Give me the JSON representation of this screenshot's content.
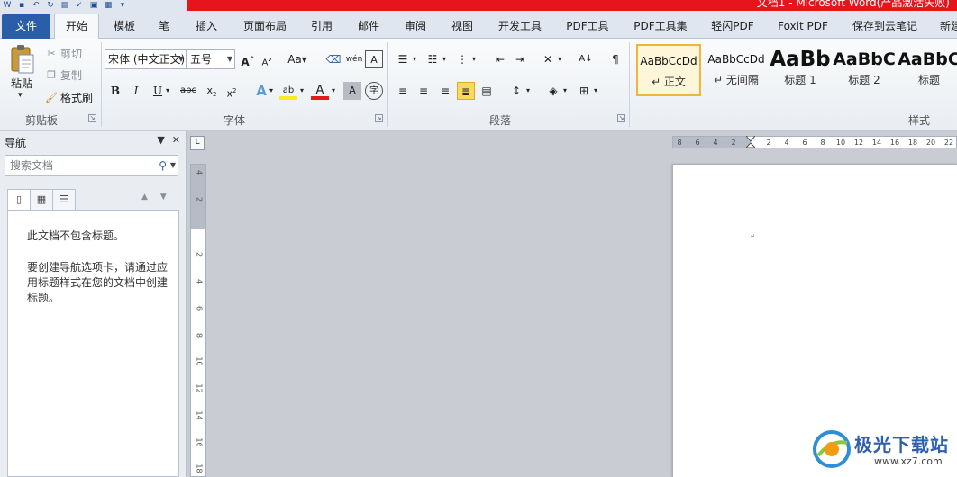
{
  "titlebar": {
    "title": "文档1 - Microsoft Word(产品激活失败)"
  },
  "tabs": [
    {
      "label": "文件"
    },
    {
      "label": "开始"
    },
    {
      "label": "模板"
    },
    {
      "label": "笔"
    },
    {
      "label": "插入"
    },
    {
      "label": "页面布局"
    },
    {
      "label": "引用"
    },
    {
      "label": "邮件"
    },
    {
      "label": "审阅"
    },
    {
      "label": "视图"
    },
    {
      "label": "开发工具"
    },
    {
      "label": "PDF工具"
    },
    {
      "label": "PDF工具集"
    },
    {
      "label": "轻闪PDF"
    },
    {
      "label": "Foxit PDF"
    },
    {
      "label": "保存到云笔记"
    },
    {
      "label": "新建"
    }
  ],
  "clipboard": {
    "paste": "粘贴",
    "cut": "剪切",
    "copy": "复制",
    "format_painter": "格式刷",
    "group": "剪贴板"
  },
  "font": {
    "name": "宋体 (中文正文)",
    "size": "五号",
    "group": "字体",
    "aa_label": "Aa"
  },
  "paragraph": {
    "group": "段落"
  },
  "styles": {
    "group": "样式",
    "items": [
      {
        "sample": "AaBbCcDd",
        "name": "↵ 正文",
        "selected": true
      },
      {
        "sample": "AaBbCcDd",
        "name": "↵ 无间隔",
        "selected": false
      },
      {
        "sample": "AaBb",
        "name": "标题 1",
        "selected": false
      },
      {
        "sample": "AaBbC",
        "name": "标题 2",
        "selected": false
      },
      {
        "sample": "AaBbC",
        "name": "标题",
        "selected": false
      }
    ]
  },
  "nav": {
    "title": "导航",
    "search_placeholder": "搜索文档",
    "msg1": "此文档不包含标题。",
    "msg2": "要创建导航选项卡，请通过应用标题样式在您的文档中创建标题。"
  },
  "hruler_ticks": [
    "8",
    "6",
    "4",
    "2",
    "2",
    "4",
    "6",
    "8",
    "10",
    "12",
    "14",
    "16",
    "18",
    "20",
    "22"
  ],
  "vruler_ticks": [
    "4",
    "2",
    "2",
    "4",
    "6",
    "8",
    "10",
    "12",
    "14",
    "16",
    "18"
  ],
  "watermark": {
    "text": "极光下载站",
    "url": "www.xz7.com"
  },
  "colors": {
    "accent": "#2b5ea8",
    "title_red": "#e8141b",
    "selected": "#fbd95a"
  }
}
